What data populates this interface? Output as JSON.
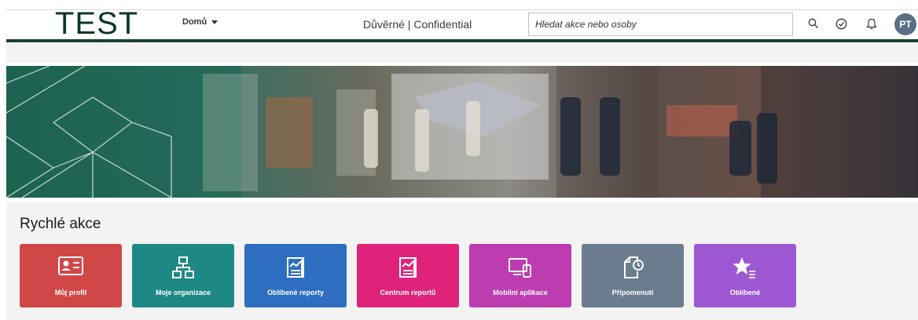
{
  "header": {
    "logo_text": "TEST",
    "home_menu_label": "Domů",
    "confidential_label": "Důvěrné | Confidential",
    "search": {
      "placeholder": "Hledat akce nebo osoby"
    },
    "icons": [
      "search-icon",
      "todo-check-icon",
      "notification-bell-icon"
    ],
    "avatar_initials": "PT"
  },
  "colors": {
    "header_green": "#19402c",
    "avatar": "#5b6f84",
    "tile_my_profile": "#d14747",
    "tile_my_org": "#1e8884",
    "tile_fav_reports": "#2e6ec0",
    "tile_report_center": "#e0237a",
    "tile_mobile_apps": "#bd3cb0",
    "tile_reminders": "#6a7c8e",
    "tile_favorites": "#9d57d3"
  },
  "quick_actions": {
    "title": "Rychlé akce",
    "tiles": [
      {
        "label": "Můj profil",
        "icon": "id-card-icon"
      },
      {
        "label": "Moje organizace",
        "icon": "org-chart-icon"
      },
      {
        "label": "Oblíbené reporty",
        "icon": "report-icon"
      },
      {
        "label": "Centrum reportů",
        "icon": "report-icon"
      },
      {
        "label": "Mobilní aplikace",
        "icon": "mobile-devices-icon"
      },
      {
        "label": "Připomenutí",
        "icon": "reminder-document-icon"
      },
      {
        "label": "Oblíbené",
        "icon": "favorite-star-list-icon"
      }
    ]
  }
}
